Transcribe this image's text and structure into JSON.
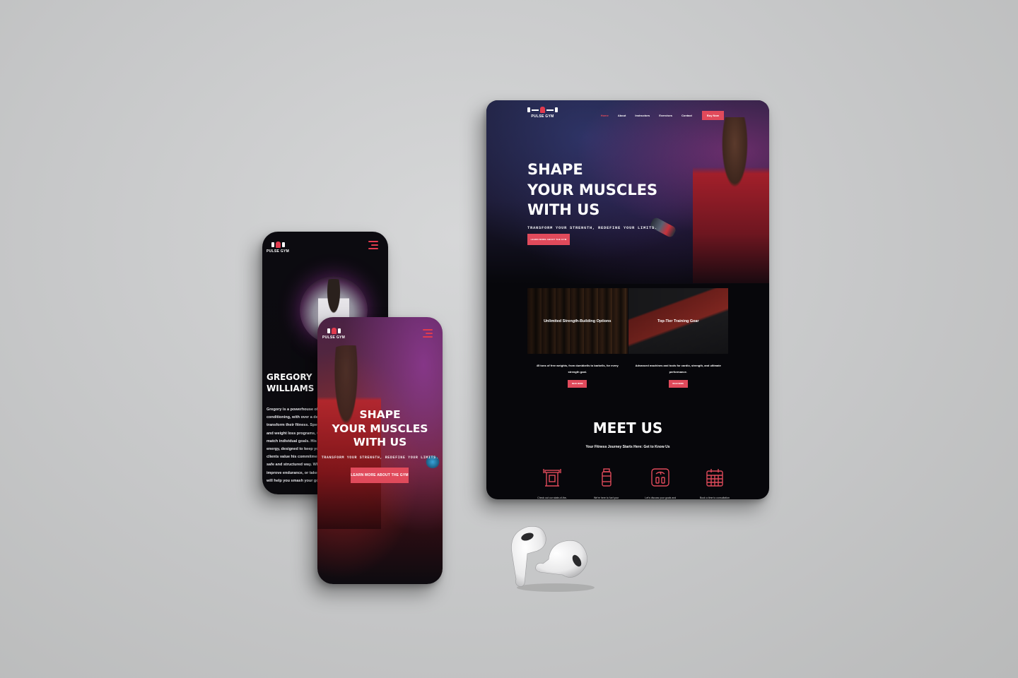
{
  "brand": {
    "name": "PULSE GYM"
  },
  "colors": {
    "accent": "#e04a5b",
    "background": "#07070b",
    "mockup_background": "#c9caca"
  },
  "instructor_phone": {
    "instructor_name": "GREGORY WILLIAMS",
    "bio_lines": [
      "Gregory is a powerhouse of k",
      "conditioning, with over a deca",
      "transform their fitness. Speci",
      "and weight loss programs, Gre",
      "match individual goals. His co",
      "energy, designed to keep you",
      "clients value his commitmen",
      "safe and structured way. Whe",
      "improve endurance, or take y",
      "will help you smash your goal"
    ]
  },
  "hero_phone": {
    "title_lines": [
      "SHAPE",
      "YOUR MUSCLES",
      "WITH US"
    ],
    "subtitle": "TRANSFORM YOUR STRENGTH, REDEFINE YOUR LIMITS.",
    "cta_label": "LEARN MORE ABOUT THE GYM"
  },
  "tablet": {
    "nav": {
      "items": [
        "Home",
        "About",
        "Instructors",
        "Exercises",
        "Contact"
      ],
      "active": "Home",
      "cta_label": "Buy Now"
    },
    "hero": {
      "title_lines": [
        "SHAPE",
        "YOUR MUSCLES",
        "WITH US"
      ],
      "subtitle": "TRANSFORM YOUR STRENGTH, REDEFINE YOUR LIMITS.",
      "cta_label": "LEARN MORE ABOUT THE GYM"
    },
    "cards": [
      {
        "label": "Unlimited Strength-Building Options",
        "desc_lines": [
          "45 tons of free weights, from dumbbells to barbells, for every",
          "strength goal."
        ],
        "button": "READ MORE"
      },
      {
        "label": "Top-Tier Training Gear",
        "desc_lines": [
          "Advanced machines and tools for cardio, strength, and ultimate",
          "performance."
        ],
        "button": "READ MORE"
      }
    ],
    "meet": {
      "title": "MEET US",
      "subtitle": "Your Fitness Journey Starts Here: Get to Know Us",
      "features": [
        {
          "icon": "gym-station-icon",
          "caption": "Check out our state-of-the-"
        },
        {
          "icon": "supplement-bottle-icon",
          "caption": "We're here to fuel your"
        },
        {
          "icon": "body-scale-icon",
          "caption": "Let's discuss your goals and"
        },
        {
          "icon": "calendar-icon",
          "caption": "Book a time to consultation"
        }
      ]
    }
  }
}
